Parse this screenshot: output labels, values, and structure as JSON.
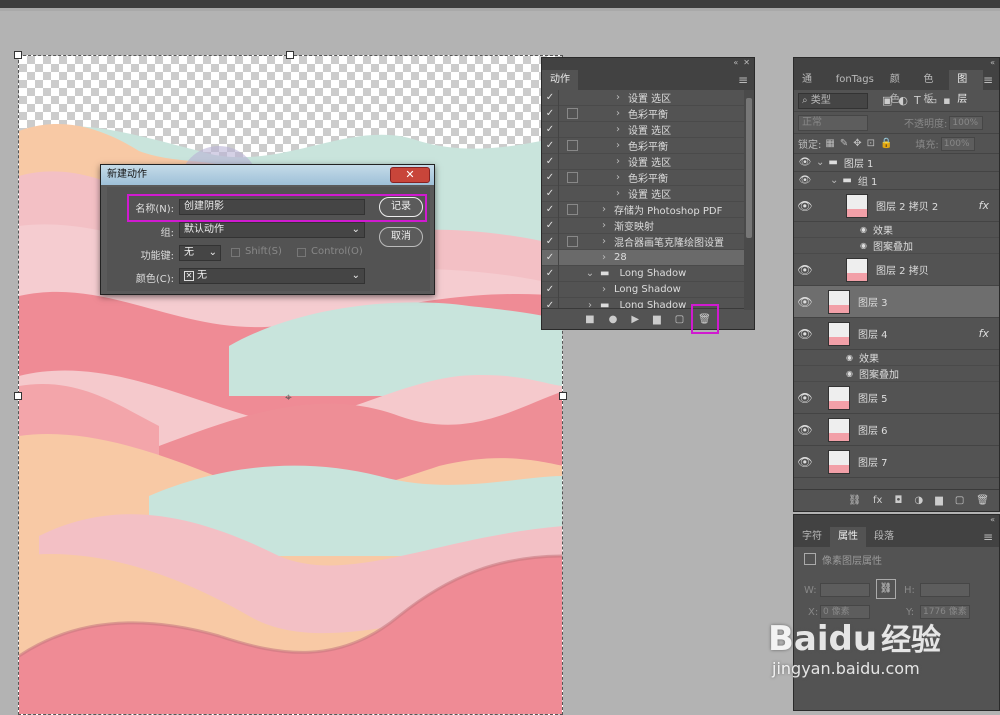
{
  "dialog": {
    "title": "新建动作",
    "close": "✕",
    "name_label": "名称(N):",
    "name_value": "创建阴影",
    "group_label": "组:",
    "group_value": "默认动作",
    "fkey_label": "功能键:",
    "fkey_value": "无",
    "shift_label": "Shift(S)",
    "control_label": "Control(O)",
    "color_label": "颜色(C):",
    "color_value": "无",
    "record_btn": "记录",
    "cancel_btn": "取消"
  },
  "actions": {
    "tab": "动作",
    "rows": [
      {
        "label": "设置 选区",
        "chk": "✓",
        "box": false,
        "indent": 3
      },
      {
        "label": "色彩平衡",
        "chk": "✓",
        "box": true,
        "indent": 3
      },
      {
        "label": "设置 选区",
        "chk": "✓",
        "box": false,
        "indent": 3
      },
      {
        "label": "色彩平衡",
        "chk": "✓",
        "box": true,
        "indent": 3
      },
      {
        "label": "设置 选区",
        "chk": "✓",
        "box": false,
        "indent": 3
      },
      {
        "label": "色彩平衡",
        "chk": "✓",
        "box": true,
        "indent": 3
      },
      {
        "label": "设置 选区",
        "chk": "✓",
        "box": false,
        "indent": 3
      },
      {
        "label": "存储为 Photoshop PDF",
        "chk": "✓",
        "box": true,
        "indent": 2
      },
      {
        "label": "渐变映射",
        "chk": "✓",
        "box": false,
        "indent": 2
      },
      {
        "label": "混合器画笔克隆绘图设置",
        "chk": "✓",
        "box": true,
        "indent": 2
      },
      {
        "label": "28",
        "chk": "✓",
        "box": false,
        "indent": 2,
        "selected": true
      },
      {
        "label": "Long Shadow",
        "chk": "✓",
        "box": false,
        "indent": 1,
        "folder": true,
        "open": true
      },
      {
        "label": "Long Shadow",
        "chk": "✓",
        "box": false,
        "indent": 2
      },
      {
        "label": "Long Shadow",
        "chk": "✓",
        "box": false,
        "indent": 1,
        "folder": true
      }
    ],
    "footer": [
      "■",
      "●",
      "▶",
      "▆",
      "▢",
      "🗑"
    ]
  },
  "layers_panel": {
    "tabs": [
      "通道",
      "fonTags",
      "颜色",
      "色板",
      "图层"
    ],
    "filter": "类型",
    "blend": "正常",
    "opacity_label": "不透明度:",
    "opacity": "100%",
    "lock_label": "锁定:",
    "fill_label": "填充:",
    "fill": "100%",
    "group1": "图层 1",
    "group2": "组 1",
    "layers": [
      {
        "name": "图层 2 拷贝 2",
        "fx": "fx",
        "effects": [
          "效果",
          "图案叠加"
        ]
      },
      {
        "name": "图层 2 拷贝",
        "fx": "",
        "effects": []
      },
      {
        "name": "图层 3",
        "fx": "",
        "effects": [],
        "selected": true
      },
      {
        "name": "图层 4",
        "fx": "fx",
        "effects": [
          "效果",
          "图案叠加"
        ]
      },
      {
        "name": "图层 5",
        "fx": "",
        "effects": []
      },
      {
        "name": "图层 6",
        "fx": "",
        "effects": []
      },
      {
        "name": "图层 7",
        "fx": "",
        "effects": []
      }
    ],
    "footer": [
      "⛓",
      "fx",
      "◘",
      "◑",
      "▆",
      "▢",
      "🗑"
    ]
  },
  "props_panel": {
    "tabs": [
      "字符",
      "属性",
      "段落"
    ],
    "title": "像素图层属性",
    "w_label": "W:",
    "h_label": "H:",
    "x_label": "X:",
    "y_label": "Y:",
    "x_value": "0 像素",
    "y_value": "1776 像素",
    "link": "⛓"
  },
  "watermark": {
    "brand": "Baidu",
    "brand_cn": "经验",
    "url": "jingyan.baidu.com"
  }
}
